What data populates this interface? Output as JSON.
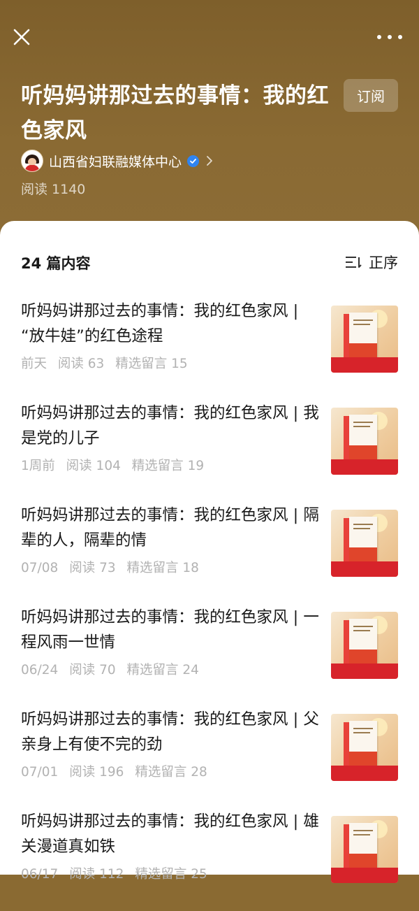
{
  "header": {
    "title": "听妈妈讲那过去的事情：我的红色家风",
    "subscribe_label": "订阅",
    "author": "山西省妇联融媒体中心",
    "read_count": "阅读 1140"
  },
  "list": {
    "count_label": "24 篇内容",
    "sort_label": "正序",
    "items": [
      {
        "title": "听妈妈讲那过去的事情：我的红色家风 | “放牛娃”的红色途程",
        "date": "前天",
        "reads": "阅读 63",
        "comments": "精选留言 15"
      },
      {
        "title": "听妈妈讲那过去的事情：我的红色家风 | 我是党的儿子",
        "date": "1周前",
        "reads": "阅读 104",
        "comments": "精选留言 19"
      },
      {
        "title": "听妈妈讲那过去的事情：我的红色家风 | 隔辈的人，隔辈的情",
        "date": "07/08",
        "reads": "阅读 73",
        "comments": "精选留言 18"
      },
      {
        "title": "听妈妈讲那过去的事情：我的红色家风 | 一程风雨一世情",
        "date": "06/24",
        "reads": "阅读 70",
        "comments": "精选留言 24"
      },
      {
        "title": "听妈妈讲那过去的事情：我的红色家风 | 父亲身上有使不完的劲",
        "date": "07/01",
        "reads": "阅读 196",
        "comments": "精选留言 28"
      },
      {
        "title": "听妈妈讲那过去的事情：我的红色家风 | 雄关漫道真如铁",
        "date": "06/17",
        "reads": "阅读 112",
        "comments": "精选留言 25"
      }
    ]
  },
  "colors": {
    "header_bg": "#8a6a32",
    "verified": "#2f84f0",
    "meta_text": "#b2b2b2"
  },
  "icons": {
    "close": "close-icon",
    "more": "more-icon",
    "verified": "verified-icon",
    "chevron": "chevron-right-icon",
    "sort": "sort-icon"
  }
}
